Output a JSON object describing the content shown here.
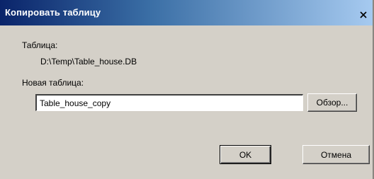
{
  "window": {
    "title": "Копировать таблицу",
    "close_symbol": "×",
    "close_icon": "close-icon"
  },
  "form": {
    "table_label": "Таблица:",
    "table_path": "D:\\Temp\\Table_house.DB",
    "new_table_label": "Новая таблица:",
    "new_table_value": "Table_house_copy",
    "browse_label": "Обзор..."
  },
  "buttons": {
    "ok_label": "OK",
    "cancel_label": "Отмена"
  },
  "colors": {
    "titlebar_start": "#0a246a",
    "titlebar_end": "#a6caf0",
    "dialog_bg": "#d4d0c8"
  }
}
